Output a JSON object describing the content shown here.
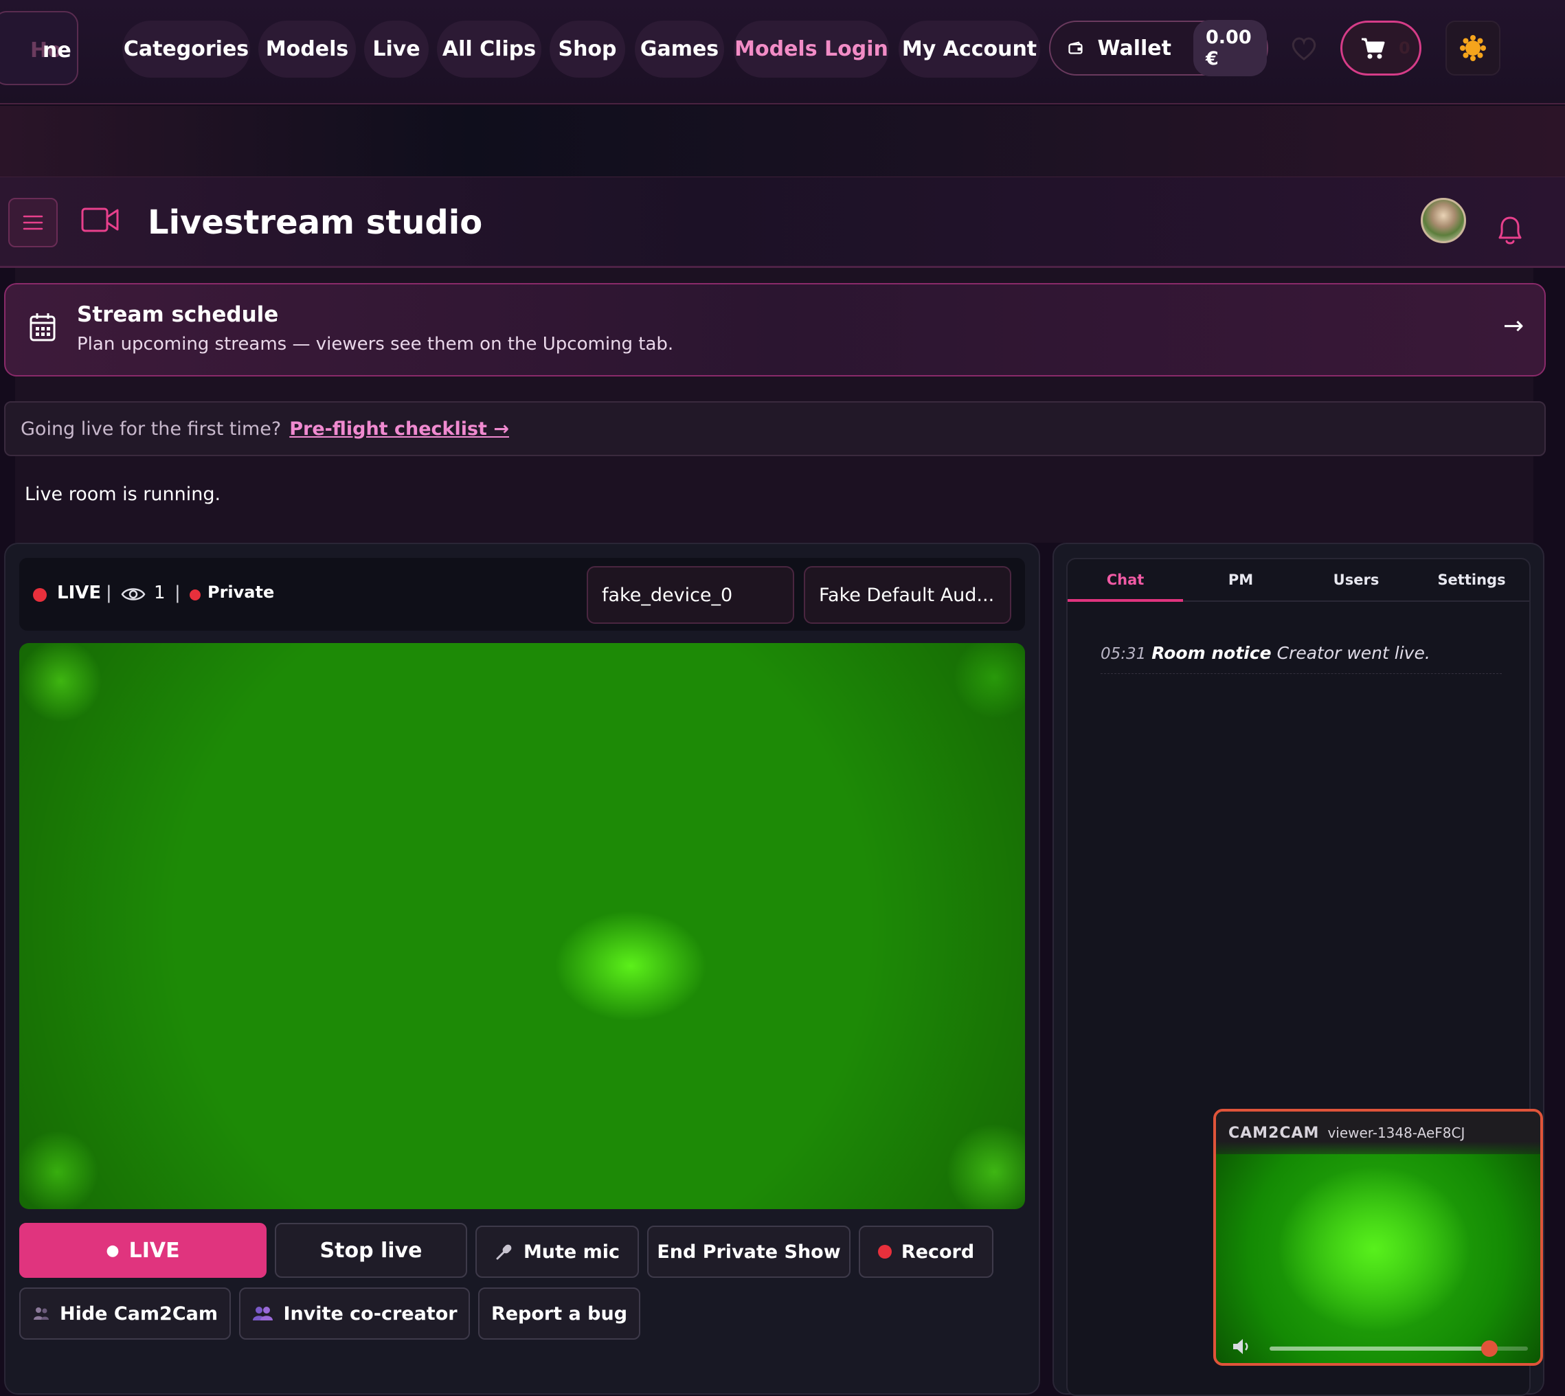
{
  "nav": {
    "home": "Home",
    "home_visible": "ne",
    "categories": "Categories",
    "models": "Models",
    "live": "Live",
    "all_clips": "All Clips",
    "shop": "Shop",
    "games": "Games",
    "models_login": "Models Login",
    "my_account": "My Account",
    "wallet_label": "Wallet",
    "wallet_amount": "0.00 €",
    "cart_count": "0",
    "accent_color": "#e0347e"
  },
  "header": {
    "title": "Livestream studio"
  },
  "schedule": {
    "title": "Stream schedule",
    "subtitle": "Plan upcoming streams — viewers see them on the Upcoming tab.",
    "arrow": "→"
  },
  "preflight": {
    "prompt": "Going live for the first time?",
    "link": "Pre-flight checklist →"
  },
  "status": {
    "running": "Live room is running."
  },
  "stream": {
    "live_label": "LIVE",
    "viewer_count": "1",
    "separator": "|",
    "private_label": "Private",
    "video_device": "fake_device_0",
    "audio_device": "Fake Default Aud..."
  },
  "controls": {
    "live": "LIVE",
    "stop_live": "Stop live",
    "mute_mic": "Mute mic",
    "end_private": "End Private Show",
    "record": "Record",
    "hide_cam2cam": "Hide Cam2Cam",
    "invite": "Invite co-creator",
    "report_bug": "Report a bug"
  },
  "chat": {
    "tabs": [
      "Chat",
      "PM",
      "Users",
      "Settings"
    ],
    "active_tab": "Chat",
    "messages": [
      {
        "time": "05:31",
        "author": "Room notice",
        "text": "Creator went live."
      }
    ]
  },
  "cam2cam": {
    "label": "CAM2CAM",
    "viewer": "viewer-1348-AeF8CJ",
    "volume": 0.85
  }
}
